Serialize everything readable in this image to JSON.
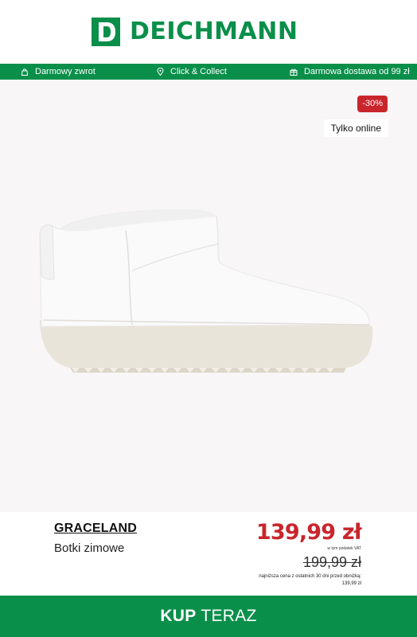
{
  "header": {
    "logo_letter": "D",
    "logo_text": "DEICHMANN"
  },
  "usp_bar": {
    "items": [
      {
        "icon": "bag-icon",
        "label": "Darmowy zwrot"
      },
      {
        "icon": "location-pin-icon",
        "label": "Click & Collect"
      },
      {
        "icon": "gift-icon",
        "label": "Darmowa dostawa od 99 zł"
      }
    ]
  },
  "product": {
    "discount_badge": "-30%",
    "online_badge": "Tylko online",
    "brand": "GRACELAND",
    "model": "Botki zimowe",
    "price": "139,99 zł",
    "vat_note": "w tym podatek VAT",
    "old_price": "199,99 zł",
    "lowest_price_note": "najniższa cena z ostatnich 30 dni przed obniżką:",
    "lowest_price_value": "139,99 zł"
  },
  "cta": {
    "label_bold": "KUP",
    "label_rest": " TERAZ"
  },
  "colors": {
    "brand_green": "#0a8f4a",
    "sale_red": "#c9252c",
    "product_bg": "#f8f6f7"
  }
}
